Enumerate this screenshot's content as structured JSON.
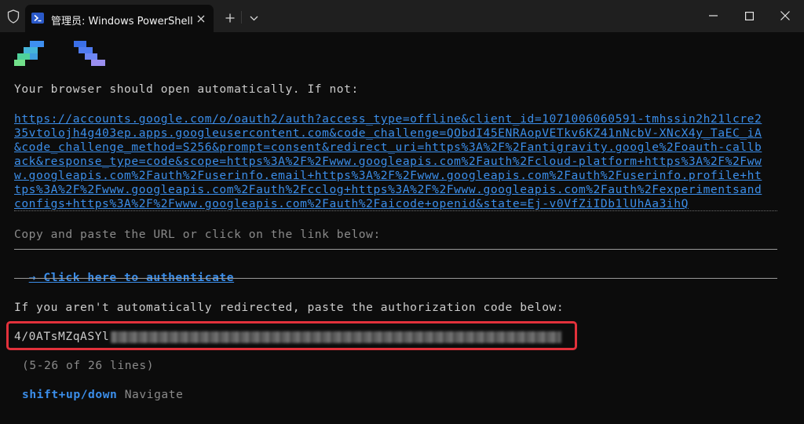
{
  "window": {
    "tab_title": "管理员: Windows PowerShell",
    "shield_icon": "shield-icon",
    "tab_icon": "powershell-icon",
    "new_tab_label": "+",
    "buttons": [
      "minimize-icon",
      "maximize-icon",
      "close-icon"
    ]
  },
  "terminal": {
    "browser_msg": "Your browser should open automatically. If not:",
    "auth_url_lines": [
      "https://accounts.google.com/o/oauth2/auth?access_type=offline&client_id=1071006060591-tmhssin2h21lcre2",
      "35vtolojh4g403ep.apps.googleusercontent.com&code_challenge=QObdI45ENRAopVETkv6KZ41nNcbV-XNcX4y_TaEC_iA",
      "&code_challenge_method=S256&prompt=consent&redirect_uri=https%3A%2F%2Fantigravity.google%2Foauth-callb",
      "ack&response_type=code&scope=https%3A%2F%2Fwww.googleapis.com%2Fauth%2Fcloud-platform+https%3A%2F%2Fww",
      "w.googleapis.com%2Fauth%2Fuserinfo.email+https%3A%2F%2Fwww.googleapis.com%2Fauth%2Fuserinfo.profile+ht",
      "tps%3A%2F%2Fwww.googleapis.com%2Fauth%2Fcclog+https%3A%2F%2Fwww.googleapis.com%2Fauth%2Fexperimentsand",
      "configs+https%3A%2F%2Fwww.googleapis.com%2Fauth%2Faicode+openid&state=Ej-v0VfZiIDb1lUhAa3ihQ"
    ],
    "copy_msg": "Copy and paste the URL or click on the link below:",
    "auth_link": "→ Click here to authenticate",
    "redirect_msg": "If you aren't automatically redirected, paste the authorization code below:",
    "code_value": "4/0ATsMZqASYl",
    "lines_status": "(5-26 of 26 lines)",
    "nav_keys": "shift+up/down",
    "nav_label": "Navigate"
  },
  "colors": {
    "background": "#0c0c0c",
    "link": "#3b8eea",
    "highlight_box": "#e2313b"
  }
}
